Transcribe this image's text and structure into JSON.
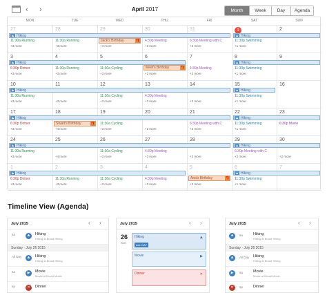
{
  "toolbar": {
    "month": "April",
    "year": "2017",
    "views": [
      "Month",
      "Week",
      "Day",
      "Agenda"
    ],
    "prev": "‹",
    "next": "›"
  },
  "weekdays": [
    "MON",
    "TUE",
    "WED",
    "THU",
    "FRI",
    "SAT",
    "SUN"
  ],
  "weeks": [
    {
      "days": [
        "27",
        "28",
        "29",
        "30",
        "31",
        "1",
        "2"
      ]
    },
    {
      "days": [
        "3",
        "4",
        "5",
        "6",
        "7",
        "8",
        "9"
      ]
    },
    {
      "days": [
        "10",
        "11",
        "12",
        "13",
        "14",
        "15",
        "16"
      ]
    },
    {
      "days": [
        "17",
        "18",
        "19",
        "20",
        "21",
        "22",
        "23"
      ]
    },
    {
      "days": [
        "24",
        "25",
        "26",
        "27",
        "28",
        "29",
        "30"
      ]
    },
    {
      "days": [
        "1",
        "2",
        "3",
        "4",
        "5",
        "6",
        "7"
      ]
    }
  ],
  "labels": {
    "hiking": "Hiking",
    "dinner": "Dinner",
    "running": "Running",
    "cycling": "Cycling",
    "meeting": "Meeting",
    "swimming": "Swimming",
    "movie": "Movie",
    "more3": "+3 more",
    "more4": "+4 more",
    "more2": "+2 more",
    "more1": "+1 more",
    "t1130": "11:30a",
    "t430": "4:30p",
    "t630": "6:30p",
    "t1130p": "11:30p",
    "meeting_with": "Meeting with C",
    "jack": "Jack's Birthday",
    "meet": "Meet's Birthday",
    "stuart": "Stuart's Birthday",
    "ana": "Ana's Birthday"
  },
  "timeline": {
    "title": "Timeline View (Agenda)",
    "panel1": {
      "month": "July 2015",
      "day_sep": "Sunday · July 26 2015",
      "rows": [
        {
          "time": "6a",
          "title": "Hiking",
          "sub": "Hiking at Broad Hiking"
        },
        {
          "time": "All Day",
          "title": "Hiking",
          "sub": "Hiking at Broad Hiking"
        },
        {
          "time": "6a",
          "title": "Movie",
          "sub": "Movie at Broad Movie"
        },
        {
          "time": "6p",
          "title": "Dinner",
          "sub": ""
        }
      ]
    },
    "panel2": {
      "month": "July 2015",
      "date": "26",
      "dow": "Sun",
      "allday": "ALL DAY",
      "cards": [
        "Hiking",
        "Movie",
        "Dinner"
      ]
    },
    "panel3": {
      "month": "July 2015",
      "day_sep": "Sunday · July 26 2015",
      "rows": [
        {
          "time": "6a",
          "title": "Hiking",
          "sub": "Hiking at Broad Hiking"
        },
        {
          "time": "All Day",
          "title": "Hiking",
          "sub": "Hiking at Broad Hiking"
        },
        {
          "time": "6a",
          "title": "Movie",
          "sub": "Movie at Broad Movie"
        },
        {
          "time": "6p",
          "title": "Dinner",
          "sub": ""
        }
      ]
    }
  },
  "colors": {
    "running": "#2e8b57",
    "cycling": "#2e8b57",
    "meeting": "#9b59b6",
    "dinner": "#c0392b",
    "swimming": "#2e7f9b",
    "movie": "#8e44ad",
    "hiking": "#3d6e9e"
  }
}
